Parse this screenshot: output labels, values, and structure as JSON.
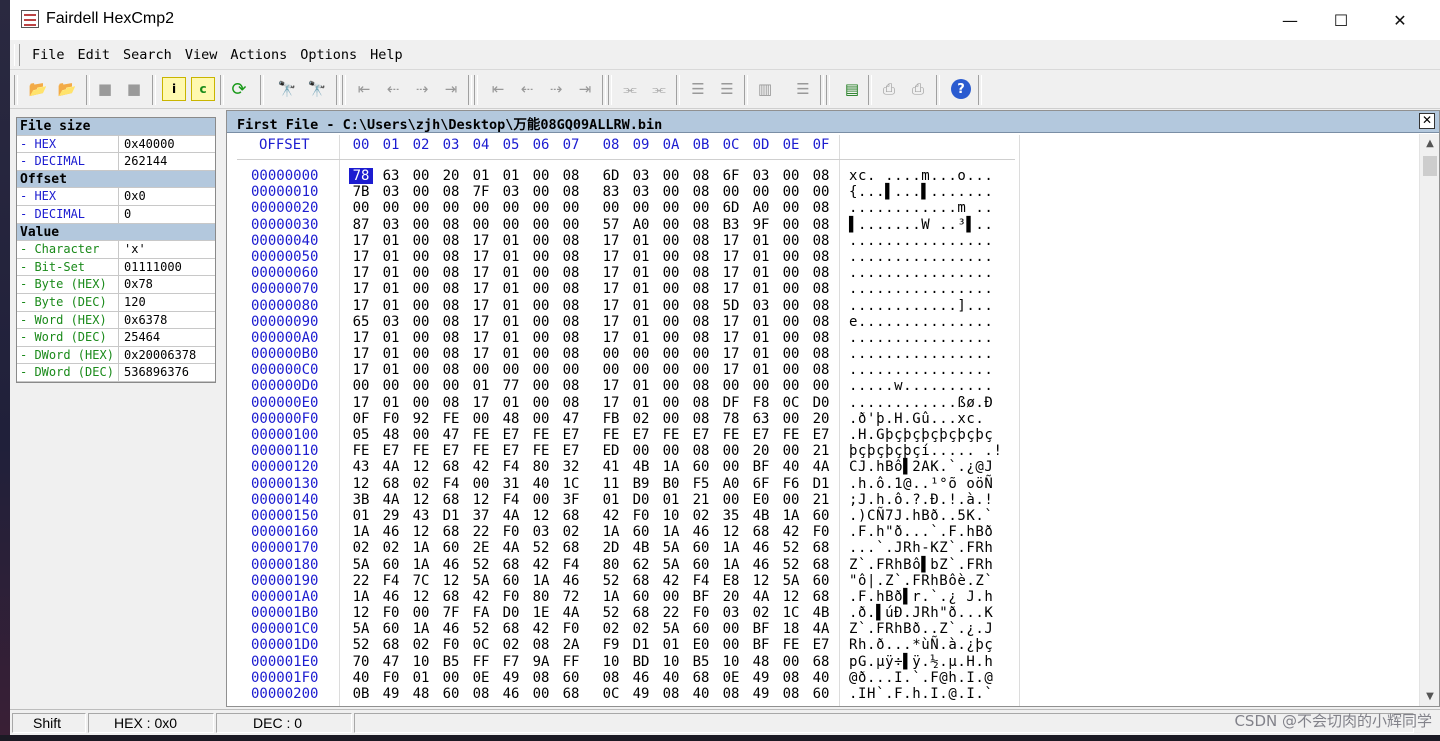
{
  "window": {
    "title": "Fairdell HexCmp2",
    "minimize": "—",
    "maximize": "☐",
    "close": "✕"
  },
  "menu": [
    "File",
    "Edit",
    "Search",
    "View",
    "Actions",
    "Options",
    "Help"
  ],
  "info": [
    {
      "k": "File size",
      "v": "",
      "type": "hdr"
    },
    {
      "k": " - HEX",
      "v": "0x40000",
      "type": "sub"
    },
    {
      "k": " - DECIMAL",
      "v": "262144",
      "type": "sub"
    },
    {
      "k": "Offset",
      "v": "",
      "type": "hdr"
    },
    {
      "k": " - HEX",
      "v": "0x0",
      "type": "sub"
    },
    {
      "k": " - DECIMAL",
      "v": "0",
      "type": "sub"
    },
    {
      "k": "Value",
      "v": "",
      "type": "hdr"
    },
    {
      "k": " - Character",
      "v": "'x'",
      "type": "grn"
    },
    {
      "k": " - Bit-Set",
      "v": "01111000",
      "type": "grn"
    },
    {
      "k": " - Byte (HEX)",
      "v": "0x78",
      "type": "grn"
    },
    {
      "k": " - Byte (DEC)",
      "v": "120",
      "type": "grn"
    },
    {
      "k": " - Word (HEX)",
      "v": "0x6378",
      "type": "grn"
    },
    {
      "k": " - Word (DEC)",
      "v": "25464",
      "type": "grn"
    },
    {
      "k": " - DWord (HEX)",
      "v": "0x20006378",
      "type": "grn"
    },
    {
      "k": " - DWord (DEC)",
      "v": "536896376",
      "type": "grn"
    }
  ],
  "hexview": {
    "title": "First File - C:\\Users\\zjh\\Desktop\\万能08GQ09ALLRW.bin",
    "offset_header": "OFFSET",
    "columns": [
      "00",
      "01",
      "02",
      "03",
      "04",
      "05",
      "06",
      "07",
      "08",
      "09",
      "0A",
      "0B",
      "0C",
      "0D",
      "0E",
      "0F"
    ],
    "rows": [
      {
        "a": "00000000",
        "h": "78 63 00 20 01 01 00 08 6D 03 00 08 6F 03 00 08",
        "t": "xc. ....m...o..."
      },
      {
        "a": "00000010",
        "h": "7B 03 00 08 7F 03 00 08 83 03 00 08 00 00 00 00",
        "t": "{...▌...▌......."
      },
      {
        "a": "00000020",
        "h": "00 00 00 00 00 00 00 00 00 00 00 00 6D A0 00 08",
        "t": "............m .."
      },
      {
        "a": "00000030",
        "h": "87 03 00 08 00 00 00 00 57 A0 00 08 B3 9F 00 08",
        "t": "▌.......W ..³▌.."
      },
      {
        "a": "00000040",
        "h": "17 01 00 08 17 01 00 08 17 01 00 08 17 01 00 08",
        "t": "................"
      },
      {
        "a": "00000050",
        "h": "17 01 00 08 17 01 00 08 17 01 00 08 17 01 00 08",
        "t": "................"
      },
      {
        "a": "00000060",
        "h": "17 01 00 08 17 01 00 08 17 01 00 08 17 01 00 08",
        "t": "................"
      },
      {
        "a": "00000070",
        "h": "17 01 00 08 17 01 00 08 17 01 00 08 17 01 00 08",
        "t": "................"
      },
      {
        "a": "00000080",
        "h": "17 01 00 08 17 01 00 08 17 01 00 08 5D 03 00 08",
        "t": "............]..."
      },
      {
        "a": "00000090",
        "h": "65 03 00 08 17 01 00 08 17 01 00 08 17 01 00 08",
        "t": "e..............."
      },
      {
        "a": "000000A0",
        "h": "17 01 00 08 17 01 00 08 17 01 00 08 17 01 00 08",
        "t": "................"
      },
      {
        "a": "000000B0",
        "h": "17 01 00 08 17 01 00 08 00 00 00 00 17 01 00 08",
        "t": "................"
      },
      {
        "a": "000000C0",
        "h": "17 01 00 08 00 00 00 00 00 00 00 00 17 01 00 08",
        "t": "................"
      },
      {
        "a": "000000D0",
        "h": "00 00 00 00 01 77 00 08 17 01 00 08 00 00 00 00",
        "t": ".....w.........."
      },
      {
        "a": "000000E0",
        "h": "17 01 00 08 17 01 00 08 17 01 00 08 DF F8 0C D0",
        "t": "............ßø.Ð"
      },
      {
        "a": "000000F0",
        "h": "0F F0 92 FE 00 48 00 47 FB 02 00 08 78 63 00 20",
        "t": ".ð'þ.H.Gû...xc. "
      },
      {
        "a": "00000100",
        "h": "05 48 00 47 FE E7 FE E7 FE E7 FE E7 FE E7 FE E7",
        "t": ".H.Gþçþçþçþçþçþç"
      },
      {
        "a": "00000110",
        "h": "FE E7 FE E7 FE E7 FE E7 ED 00 00 08 00 20 00 21",
        "t": "þçþçþçþçí..... .!"
      },
      {
        "a": "00000120",
        "h": "43 4A 12 68 42 F4 80 32 41 4B 1A 60 00 BF 40 4A",
        "t": "CJ.hBô▌2AK.`.¿@J"
      },
      {
        "a": "00000130",
        "h": "12 68 02 F4 00 31 40 1C 11 B9 B0 F5 A0 6F F6 D1",
        "t": ".h.ô.1@..¹°õ oöÑ"
      },
      {
        "a": "00000140",
        "h": "3B 4A 12 68 12 F4 00 3F 01 D0 01 21 00 E0 00 21",
        "t": ";J.h.ô.?.Ð.!.à.!"
      },
      {
        "a": "00000150",
        "h": "01 29 43 D1 37 4A 12 68 42 F0 10 02 35 4B 1A 60",
        "t": ".)CÑ7J.hBð..5K.`"
      },
      {
        "a": "00000160",
        "h": "1A 46 12 68 22 F0 03 02 1A 60 1A 46 12 68 42 F0",
        "t": ".F.h\"ð...`.F.hBð"
      },
      {
        "a": "00000170",
        "h": "02 02 1A 60 2E 4A 52 68 2D 4B 5A 60 1A 46 52 68",
        "t": "...`.JRh-KZ`.FRh"
      },
      {
        "a": "00000180",
        "h": "5A 60 1A 46 52 68 42 F4 80 62 5A 60 1A 46 52 68",
        "t": "Z`.FRhBô▌bZ`.FRh"
      },
      {
        "a": "00000190",
        "h": "22 F4 7C 12 5A 60 1A 46 52 68 42 F4 E8 12 5A 60",
        "t": "\"ô|.Z`.FRhBôè.Z`"
      },
      {
        "a": "000001A0",
        "h": "1A 46 12 68 42 F0 80 72 1A 60 00 BF 20 4A 12 68",
        "t": ".F.hBð▌r.`.¿ J.h"
      },
      {
        "a": "000001B0",
        "h": "12 F0 00 7F FA D0 1E 4A 52 68 22 F0 03 02 1C 4B",
        "t": ".ð.▌úÐ.JRh\"ð...K"
      },
      {
        "a": "000001C0",
        "h": "5A 60 1A 46 52 68 42 F0 02 02 5A 60 00 BF 18 4A",
        "t": "Z`.FRhBð..Z`.¿.J"
      },
      {
        "a": "000001D0",
        "h": "52 68 02 F0 0C 02 08 2A F9 D1 01 E0 00 BF FE E7",
        "t": "Rh.ð...*ùÑ.à.¿þç"
      },
      {
        "a": "000001E0",
        "h": "70 47 10 B5 FF F7 9A FF 10 BD 10 B5 10 48 00 68",
        "t": "pG.µÿ÷▌ÿ.½.µ.H.h"
      },
      {
        "a": "000001F0",
        "h": "40 F0 01 00 0E 49 08 60 08 46 40 68 0E 49 08 40",
        "t": "@ð...I.`.F@h.I.@"
      },
      {
        "a": "00000200",
        "h": "0B 49 48 60 08 46 00 68 0C 49 08 40 08 49 08 60",
        "t": ".IH`.F.h.I.@.I.`"
      }
    ]
  },
  "status": {
    "shift": "Shift",
    "hex": "HEX : 0x0",
    "dec": "DEC : 0"
  },
  "watermark": "CSDN @不会切肉的小辉同学",
  "toolbar_icons": [
    "open-file-1-icon",
    "open-file-2-icon",
    "stop-icon",
    "stop-2-icon",
    "info-icon",
    "compare-icon",
    "refresh-icon",
    "find-icon",
    "find-next-icon",
    "first-diff-icon",
    "prev-diff-icon",
    "next-diff-icon",
    "last-diff-icon",
    "first-diff-2-icon",
    "prev-diff-2-icon",
    "next-diff-2-icon",
    "last-diff-2-icon",
    "split-icon",
    "merge-icon",
    "align-left-icon",
    "align-right-icon",
    "columns-icon",
    "list-icon",
    "report-icon",
    "print-icon",
    "print-preview-icon",
    "help-icon"
  ]
}
